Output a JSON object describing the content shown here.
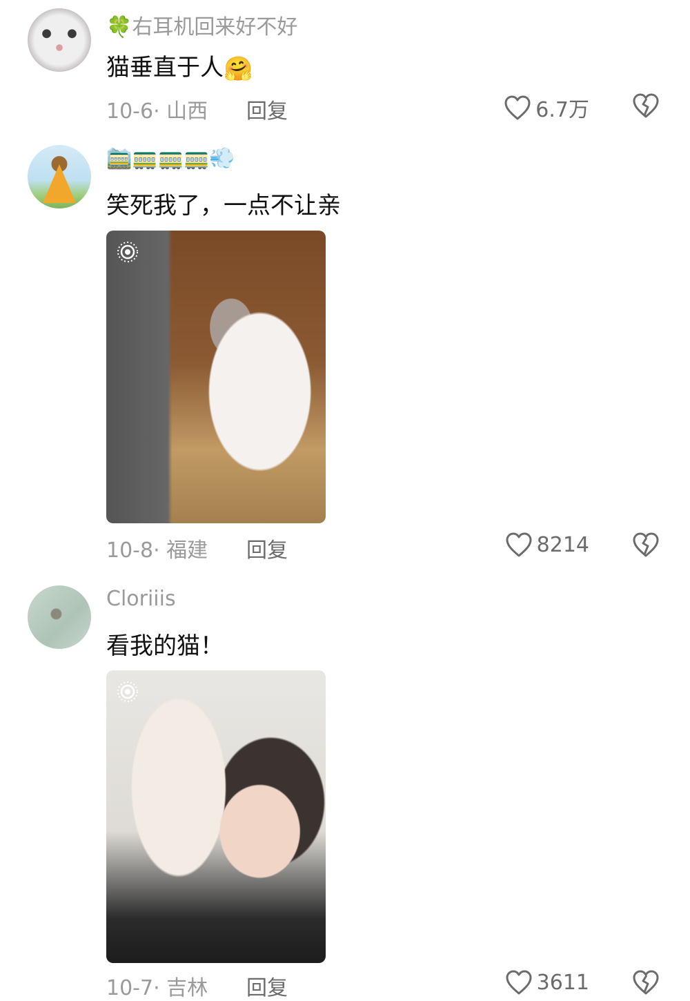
{
  "comments": [
    {
      "username": "🍀右耳机回来好不好",
      "text": "猫垂直于人",
      "text_emoji": "🤗",
      "date_location": "10-6· 山西",
      "reply_label": "回复",
      "likes": "6.7万"
    },
    {
      "username": "🚞🚃🚃🚃💨",
      "text": "笑死我了，一点不让亲",
      "date_location": "10-8· 福建",
      "reply_label": "回复",
      "likes": "8214"
    },
    {
      "username": "Cloriiis",
      "text": "看我的猫！",
      "date_location": "10-7· 吉林",
      "reply_label": "回复",
      "likes": "3611"
    }
  ],
  "icons": {
    "like": "heart-outline-icon",
    "dislike": "broken-heart-icon",
    "live_photo": "live-photo-icon"
  },
  "colors": {
    "meta_text": "#9a9a9a",
    "body_text": "#111111",
    "icon": "#6b6b6b"
  }
}
